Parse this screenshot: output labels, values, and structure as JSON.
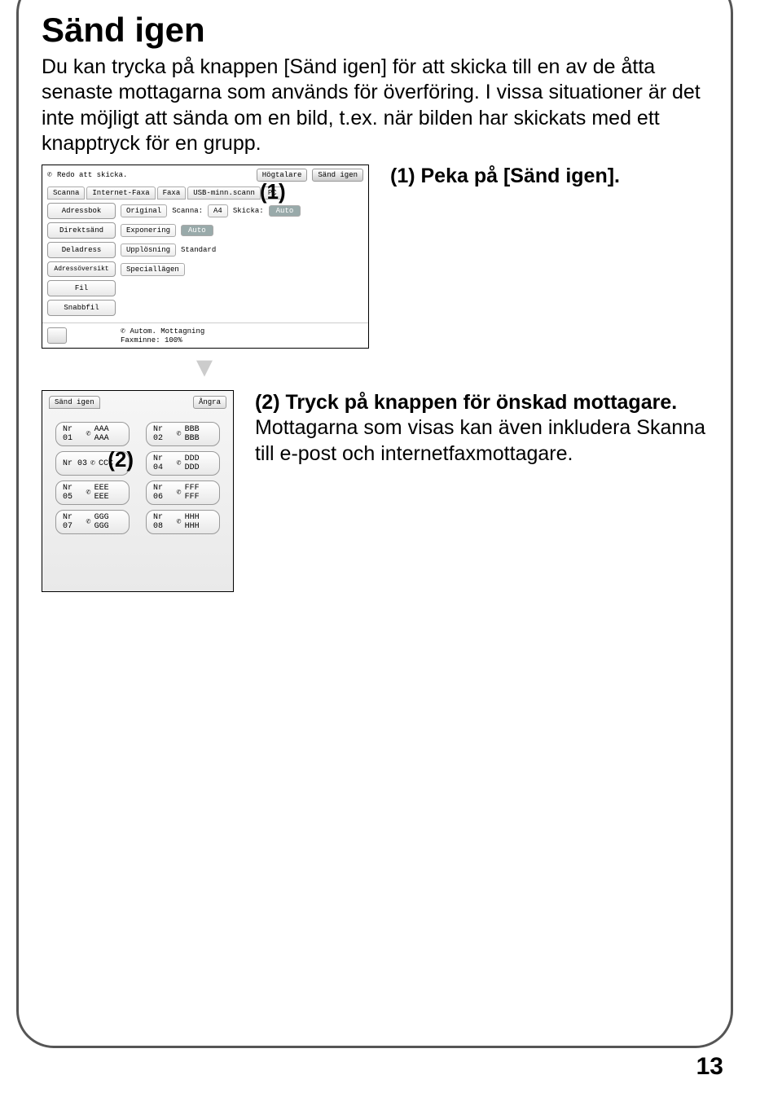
{
  "title": "Sänd igen",
  "intro": "Du kan trycka på knappen [Sänd igen] för att skicka till en av de åtta senaste mottagarna som används för överföring.\nI vissa situationer är det inte möjligt att sända om en bild, t.ex. när bilden har skickats med ett knapptryck för en grupp.",
  "step1": "(1) Peka på [Sänd igen].",
  "step2_title": "(2) Tryck på knappen för önskad mottagare.",
  "step2_body": "Mottagarna som visas kan även inkludera Skanna till e-post och internetfaxmottagare.",
  "panel1": {
    "status": "Redo att skicka.",
    "btn_hogtalare": "Högtalare",
    "btn_sand_igen": "Sänd igen",
    "tabs": [
      "Scanna",
      "Internet-Faxa",
      "Faxa",
      "USB-minn.scann",
      "PC"
    ],
    "overlay1": "(1)",
    "side": [
      "Adressbok",
      "Direktsänd",
      "Deladress",
      "Adressöversikt",
      "Fil",
      "Snabbfil"
    ],
    "col2": [
      "Original",
      "Exponering",
      "Upplösning",
      "Speciallägen"
    ],
    "col3_scanna": "Scanna:",
    "col3_a4": "A4",
    "col3_auto": "Auto",
    "col3_standard": "Standard",
    "col3_skicka": "Skicka:",
    "col3_auto2": "Auto",
    "footer1": "Autom. Mottagning",
    "footer2": "Faxminne: 100%"
  },
  "panel2": {
    "title": "Sänd igen",
    "cancel": "Ångra",
    "overlay2": "(2)",
    "items": [
      {
        "no": "Nr 01",
        "name": "AAA AAA"
      },
      {
        "no": "Nr 02",
        "name": "BBB BBB"
      },
      {
        "no": "Nr 03",
        "name": "CCC"
      },
      {
        "no": "Nr 04",
        "name": "DDD DDD"
      },
      {
        "no": "Nr 05",
        "name": "EEE EEE"
      },
      {
        "no": "Nr 06",
        "name": "FFF FFF"
      },
      {
        "no": "Nr 07",
        "name": "GGG GGG"
      },
      {
        "no": "Nr 08",
        "name": "HHH HHH"
      }
    ]
  },
  "pagenum": "13"
}
